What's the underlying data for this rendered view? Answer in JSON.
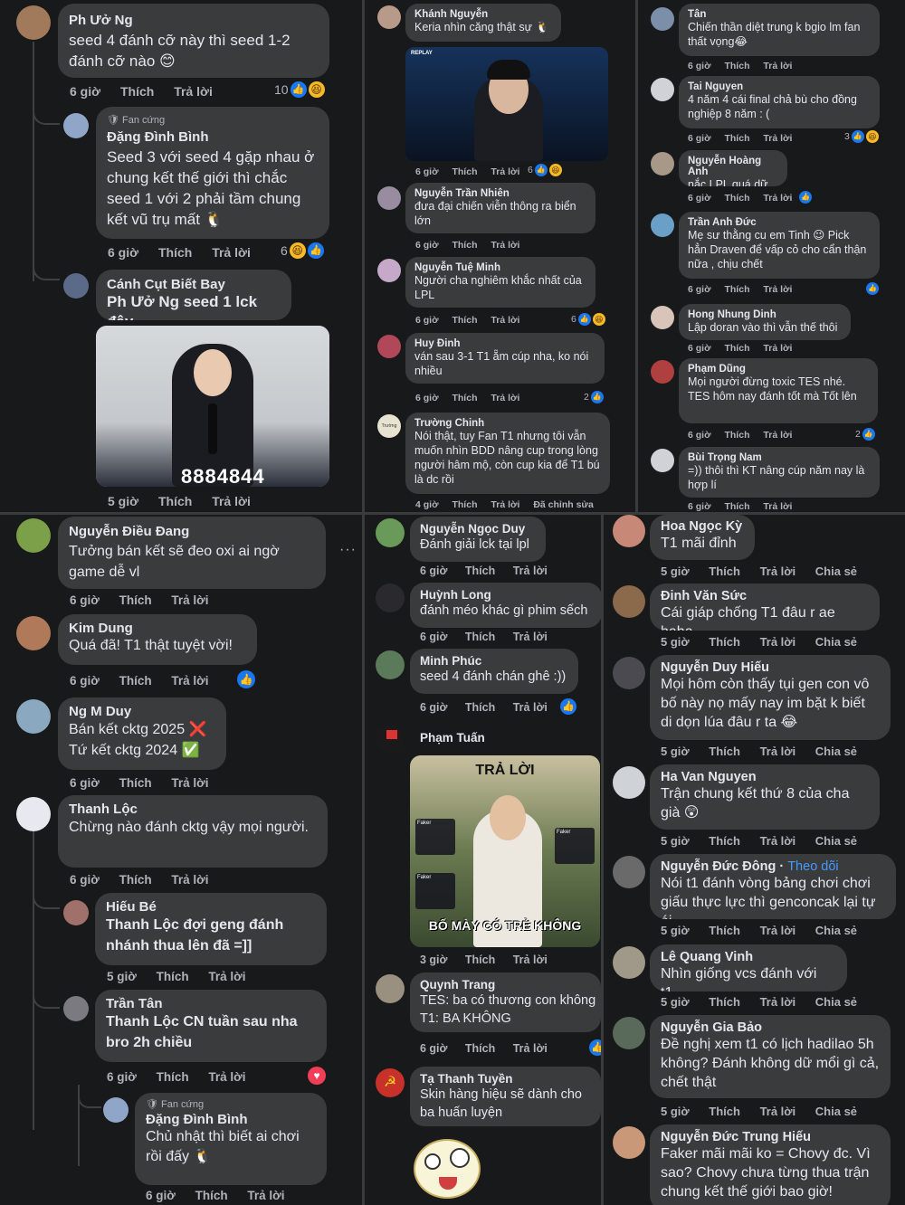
{
  "actions": {
    "like": "Thích",
    "reply": "Trả lời",
    "share": "Chia sẻ",
    "edited": "Đã chỉnh sửa",
    "follow": "Theo dõi",
    "fan_badge": "Fan cứng"
  },
  "p1": [
    {
      "name": "Ph Ưở Ng",
      "text": "seed 4 đánh cỡ này thì seed 1-2 đánh cỡ nào 😊",
      "time": "6 giờ",
      "count": "10"
    },
    {
      "name": "Đặng Đình Bình",
      "text": "Seed 3 với seed 4 gặp nhau ở chung kết thế giới thì chắc seed 1 với 2 phải tầm chung kết vũ trụ mất 🐧",
      "time": "6 giờ",
      "count": "6"
    },
    {
      "name": "Cánh Cụt Biết Bay",
      "text": "Ph Ưở Ng seed 1 lck đây",
      "time": "5 giờ",
      "image_text": "8884844"
    }
  ],
  "p2": [
    {
      "name": "Khánh Nguyễn",
      "text": "Keria nhìn căng thật sự 🐧",
      "time": "6 giờ",
      "count": "6",
      "image_text": "REPLAY"
    },
    {
      "name": "Nguyễn Trần Nhiên",
      "text": "đưa đại chiến viễn thông ra biển lớn",
      "time": "6 giờ"
    },
    {
      "name": "Nguyễn Tuệ Minh",
      "text": "Người cha nghiêm khắc nhất của LPL",
      "time": "6 giờ",
      "count": "6"
    },
    {
      "name": "Huy Đinh",
      "text": "ván sau 3-1 T1 ẵm cúp nha, ko nói nhiều",
      "time": "6 giờ",
      "count": "2"
    },
    {
      "name": "Trường Chinh",
      "text": "Nói thật, tuy Fan T1 nhưng tôi vẫn muốn nhìn BDD nâng cup trong lòng người hâm mộ, còn cup kia để T1 bú là dc rồi",
      "time": "4 giờ",
      "avatar_text": "Trường Chinh"
    }
  ],
  "p3": [
    {
      "name": "Tân",
      "text": "Chiến thần diệt trung k bgio lm fan thất vọng😂",
      "time": "6 giờ"
    },
    {
      "name": "Tai Nguyen",
      "text": "4 năm 4 cái final chả bù cho đồng nghiệp 8 năm : (",
      "time": "6 giờ",
      "count": "3"
    },
    {
      "name": "Nguyễn Hoàng Anh",
      "text": "nắc LPL quá dữ",
      "time": "6 giờ"
    },
    {
      "name": "Trần Anh Đức",
      "text": "Mẹ sư thằng cu em Tinh 😉 Pick hẳn Draven để vấp cỏ cho cẩn thận nữa , chịu chết",
      "time": "6 giờ"
    },
    {
      "name": "Hong Nhung Dinh",
      "text": "Lập doran vào thì vẫn thế thôi",
      "time": "6 giờ"
    },
    {
      "name": "Phạm Dũng",
      "text": "Mọi người đừng toxic TES nhé. TES hôm nay đánh tốt mà Tốt lên",
      "time": "6 giờ",
      "count": "2"
    },
    {
      "name": "Bùi Trọng Nam",
      "text": "=)) thôi thì KT nâng cúp năm nay là hợp lí",
      "time": "6 giờ"
    }
  ],
  "p4": [
    {
      "name": "Nguyễn Điều Đang",
      "text": "Tưởng bán kết sẽ đeo oxi ai ngờ game dễ vl",
      "time": "6 giờ"
    },
    {
      "name": "Kim Dung",
      "text": "Quá đã! T1 thật tuyệt vời!",
      "time": "6 giờ"
    },
    {
      "name": "Ng M Duy",
      "text": "Bán kết cktg 2025 ❌",
      "text2": "Tứ kết cktg 2024 ✅",
      "time": "6 giờ"
    },
    {
      "name": "Thanh Lộc",
      "text": "Chừng nào đánh cktg vậy mọi người.",
      "time": "6 giờ"
    },
    {
      "name": "Hiếu Bé",
      "text": "Thanh Lộc đợi geng đánh nhánh thua lên đã =]]",
      "time": "5 giờ"
    },
    {
      "name": "Trần Tân",
      "text": "Thanh Lộc CN tuần sau nha bro 2h chiều",
      "time": "6 giờ"
    },
    {
      "name": "Đặng Đình Bình",
      "text": "Chủ nhật thì biết ai chơi rồi đấy 🐧",
      "time": "6 giờ"
    }
  ],
  "p5": [
    {
      "name": "Nguyễn Ngọc Duy",
      "text": "Đánh giải lck tại lpl",
      "time": "6 giờ"
    },
    {
      "name": "Huỳnh Long",
      "text": "đánh méo khác gì phim sếch",
      "time": "6 giờ"
    },
    {
      "name": "Minh Phúc",
      "text": "seed 4 đánh chán ghê :))",
      "time": "6 giờ"
    },
    {
      "name": "Phạm Tuấn",
      "time": "3 giờ",
      "image_top": "TRẢ LỜI",
      "image_bottom": "BỐ MÀY CÓ TRẺ KHÔNG",
      "image_side": "Faker"
    },
    {
      "name": "Quynh Trang",
      "text": "TES: ba có thương con không",
      "text2": "T1: BA KHÔNG",
      "time": "6 giờ"
    },
    {
      "name": "Tạ Thanh Tuyền",
      "text": "Skin hàng hiệu sẽ dành cho ba huấn luyện"
    }
  ],
  "p6": [
    {
      "name": "Hoa Ngọc Kỳ",
      "text": "T1 mãi đỉnh",
      "time": "5 giờ"
    },
    {
      "name": "Đinh Văn Sức",
      "text": "Cái giáp chống T1 đâu r ae haha",
      "time": "5 giờ"
    },
    {
      "name": "Nguyễn Duy Hiếu",
      "text": "Mọi hôm còn thấy tụi gen con vô bố này nọ mấy nay im bặt k biết di dọn lúa đâu r ta 😂",
      "time": "5 giờ"
    },
    {
      "name": "Ha Van Nguyen",
      "text": "Trận chung kết thứ 8 của cha già 😲",
      "time": "5 giờ"
    },
    {
      "name": "Nguyễn Đức Đông",
      "text": "Nói t1 đánh vòng bảng chơi chơi giấu thực lực thì genconcak lại tự ái",
      "time": "5 giờ"
    },
    {
      "name": "Lê Quang Vinh",
      "text": "Nhìn giống vcs đánh với t1.",
      "time": "5 giờ"
    },
    {
      "name": "Nguyễn Gia Bảo",
      "text": "Đề nghị xem t1 có lịch hadilao 5h không? Đánh không dữ mổi gì cả, chết thật",
      "time": "5 giờ"
    },
    {
      "name": "Nguyễn Đức Trung Hiếu",
      "text": "Faker mãi mãi ko = Chovy đc. Vì sao? Chovy chưa từng thua trận chung kết thế giới bao giờ!"
    }
  ],
  "colors": {
    "bg": "#18191a",
    "bubble": "#3a3b3c",
    "text": "#e4e6eb",
    "muted": "#b0b3b8",
    "like": "#1877f2",
    "haha": "#f7b928",
    "heart": "#f33e58",
    "link": "#4599ff"
  }
}
